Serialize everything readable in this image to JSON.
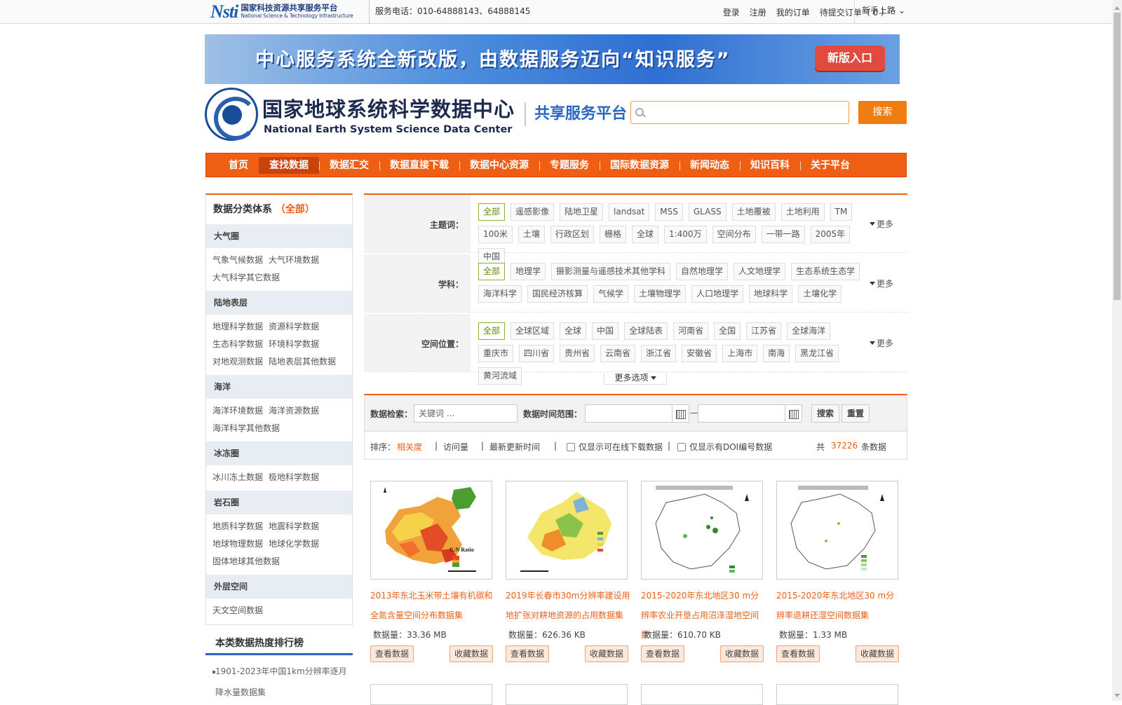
{
  "topbar": {
    "logo_mark": "Nsti",
    "logo_cn": "国家科技资源共享服务平台",
    "logo_en": "National Science & Technology Infrastructure",
    "phone": "服务电话：010-64888143、64888145",
    "links": [
      "登录",
      "注册",
      "我的订单",
      "待提交订单（ 0 ）"
    ],
    "guide": "新手上路"
  },
  "banner": {
    "text": "中心服务系统全新改版，由数据服务迈向“知识服务”",
    "button": "新版入口"
  },
  "brand": {
    "name_cn": "国家地球系统科学数据中心",
    "name_en": "National Earth System Science Data Center",
    "platform": "共享服务平台"
  },
  "search": {
    "placeholder": "",
    "button": "搜索"
  },
  "nav": {
    "items": [
      "首页",
      "查找数据",
      "数据汇交",
      "数据直接下载",
      "数据中心资源",
      "专题服务",
      "国际数据资源",
      "新闻动态",
      "知识百科",
      "关于平台"
    ],
    "active_index": 1
  },
  "sidebar": {
    "title": "数据分类体系",
    "title_all": "（全部）",
    "categories": [
      {
        "name": "大气圈",
        "links": [
          "气象气候数据",
          "大气环境数据",
          "大气科学其它数据"
        ]
      },
      {
        "name": "陆地表层",
        "links": [
          "地理科学数据",
          "资源科学数据",
          "生态科学数据",
          "环境科学数据",
          "对地观测数据",
          "陆地表层其他数据"
        ]
      },
      {
        "name": "海洋",
        "links": [
          "海洋环境数据",
          "海洋资源数据",
          "海洋科学其他数据"
        ]
      },
      {
        "name": "冰冻圈",
        "links": [
          "冰川冻土数据",
          "极地科学数据"
        ]
      },
      {
        "name": "岩石圈",
        "links": [
          "地质科学数据",
          "地震科学数据",
          "地球物理数据",
          "地球化学数据",
          "固体地球其他数据"
        ]
      },
      {
        "name": "外层空间",
        "links": [
          "天文空间数据"
        ]
      }
    ]
  },
  "ranking": {
    "title": "本类数据热度排行榜",
    "items": [
      "1901-2023年中国1km分辨率逐月降水量数据集"
    ]
  },
  "filters": {
    "rows": [
      {
        "label": "主题词：",
        "tags": [
          "全部",
          "遥感影像",
          "陆地卫星",
          "landsat",
          "MSS",
          "GLASS",
          "土地覆被",
          "土地利用",
          "TM",
          "100米",
          "土壤",
          "行政区划",
          "栅格",
          "全球",
          "1:400万",
          "空间分布",
          "一带一路",
          "2005年",
          "中国"
        ],
        "more": "更多"
      },
      {
        "label": "学科：",
        "tags": [
          "全部",
          "地理学",
          "摄影测量与遥感技术其他学科",
          "自然地理学",
          "人文地理学",
          "生态系统生态学",
          "海洋科学",
          "国民经济核算",
          "气候学",
          "土壤物理学",
          "人口地理学",
          "地球科学",
          "土壤化学"
        ],
        "more": "更多"
      },
      {
        "label": "空间位置：",
        "tags": [
          "全部",
          "全球区域",
          "全球",
          "中国",
          "全球陆表",
          "河南省",
          "全国",
          "江苏省",
          "全球海洋",
          "重庆市",
          "四川省",
          "贵州省",
          "云南省",
          "浙江省",
          "安徽省",
          "上海市",
          "南海",
          "黑龙江省",
          "黄河流域"
        ],
        "more": "更多"
      }
    ],
    "more_options": "更多选项"
  },
  "query": {
    "keyword_label": "数据检索：",
    "keyword_placeholder": "关键词 ...",
    "time_label": "数据时间范围：",
    "dash": "—",
    "search_btn": "搜索",
    "reset_btn": "重置",
    "sort_label": "排序：",
    "sort_options": [
      "相关度",
      "访问量",
      "最新更新时间"
    ],
    "check_online": "仅显示可在线下载数据",
    "check_doi": "仅显示有DOI编号数据",
    "total_prefix": "共",
    "total": "37226",
    "total_suffix": "条数据"
  },
  "cards": [
    {
      "title": "2013年东北玉米带土壤有机碳和全氮含量空间分布数据集",
      "size": "数据量：33.36 MB",
      "view": "查看数据",
      "fav": "收藏数据",
      "map_legend": "C:N Ratio"
    },
    {
      "title": "2019年长春市30m分辨率建设用地扩张对耕地资源的占用数据集",
      "size": "数据量：626.36 KB",
      "view": "查看数据",
      "fav": "收藏数据",
      "map_legend": ""
    },
    {
      "title": "2015-2020年东北地区30 m分辨率农业开垦占用沼泽湿地空间数",
      "size": "数据量：610.70 KB",
      "view": "查看数据",
      "fav": "收藏数据",
      "map_legend": ""
    },
    {
      "title": "2015-2020年东北地区30 m分辨率退耕还湿空间数据集",
      "size": "数据量：1.33 MB",
      "view": "查看数据",
      "fav": "收藏数据",
      "map_legend": ""
    }
  ]
}
